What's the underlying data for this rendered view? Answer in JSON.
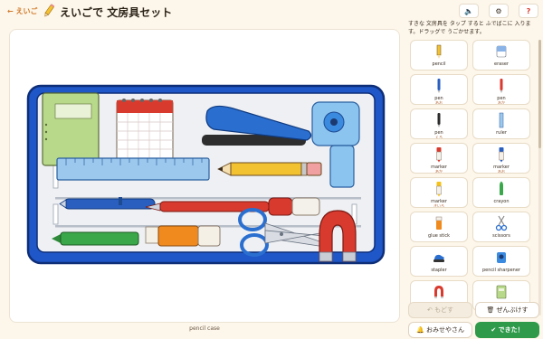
{
  "header": {
    "back_label": "← えいご",
    "title": "えいごで 文房具セット",
    "title_icon": "pencil-icon",
    "buttons": [
      {
        "name": "sound-button",
        "icon": "speaker-icon",
        "symbol": "🔈"
      },
      {
        "name": "settings-button",
        "icon": "gear-icon",
        "symbol": "⚙"
      },
      {
        "name": "help-button",
        "icon": "question-icon",
        "symbol": "?"
      }
    ]
  },
  "canvas": {
    "caption": "pencil case"
  },
  "panel": {
    "instructions": "すきな 文房具を タップ すると ふでばこに 入ります。ドラッグで うごかせます。",
    "items": [
      {
        "label": "pencil",
        "sub": "",
        "icon": "pencil-icon",
        "color": "#f2c230"
      },
      {
        "label": "eraser",
        "sub": "",
        "icon": "eraser-icon",
        "color": "#8ab4e8"
      },
      {
        "label": "pen",
        "sub": "あお",
        "icon": "pen-icon",
        "color": "#2a5fc0"
      },
      {
        "label": "pen",
        "sub": "あか",
        "icon": "pen-icon",
        "color": "#d83a2e"
      },
      {
        "label": "pen",
        "sub": "くろ",
        "icon": "pen-icon",
        "color": "#2b2b2b"
      },
      {
        "label": "ruler",
        "sub": "",
        "icon": "ruler-icon",
        "color": "#9cc8ee"
      },
      {
        "label": "marker",
        "sub": "あか",
        "icon": "marker-icon",
        "color": "#d83a2e"
      },
      {
        "label": "marker",
        "sub": "あお",
        "icon": "marker-icon",
        "color": "#2a5fc0"
      },
      {
        "label": "marker",
        "sub": "きいろ",
        "icon": "marker-icon",
        "color": "#f5c21a"
      },
      {
        "label": "crayon",
        "sub": "",
        "icon": "crayon-icon",
        "color": "#3aa84a"
      },
      {
        "label": "glue stick",
        "sub": "",
        "icon": "glue-stick-icon",
        "color": "#f08a1e"
      },
      {
        "label": "scissors",
        "sub": "",
        "icon": "scissors-icon",
        "color": "#2a6fd0"
      },
      {
        "label": "stapler",
        "sub": "",
        "icon": "stapler-icon",
        "color": "#2a6fd0"
      },
      {
        "label": "pencil sharpener",
        "sub": "",
        "icon": "sharpener-icon",
        "color": "#3a8ae0"
      },
      {
        "label": "magnet",
        "sub": "",
        "icon": "magnet-icon",
        "color": "#d83a2e"
      },
      {
        "label": "notebook",
        "sub": "",
        "icon": "notebook-icon",
        "color": "#b9d98a"
      },
      {
        "label": "",
        "sub": "",
        "icon": "pen-icon",
        "color": "#d83a2e"
      },
      {
        "label": "",
        "sub": "",
        "icon": "pen-icon",
        "color": "#2a5fc0"
      }
    ]
  },
  "actions": {
    "undo_label": "↶ もどす",
    "clear_label": "🗑 ぜんぶけす",
    "example_label": "🔔 おみせやさん",
    "done_label": "✔ できた！"
  },
  "colors": {
    "accent": "#d07a2a",
    "case_blue": "#1f56c8",
    "done_green": "#2e9a4a"
  }
}
